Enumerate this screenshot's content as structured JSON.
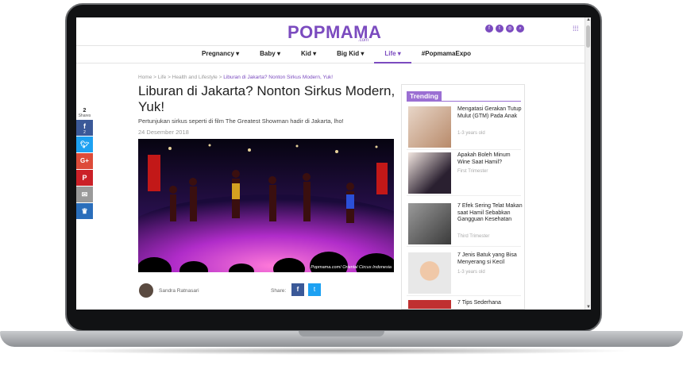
{
  "header": {
    "logo": "POPMAMA",
    "logo_sub": ".com",
    "social_icons": [
      "facebook-icon",
      "twitter-icon",
      "instagram-icon",
      "search-icon"
    ]
  },
  "nav": {
    "items": [
      {
        "label": "Pregnancy ▾"
      },
      {
        "label": "Baby ▾"
      },
      {
        "label": "Kid ▾"
      },
      {
        "label": "Big Kid ▾"
      },
      {
        "label": "Life ▾"
      },
      {
        "label": "#PopmamaExpo"
      }
    ],
    "active_index": 4
  },
  "sharebar": {
    "count": "2",
    "label": "Shares",
    "fb_count": "2"
  },
  "article": {
    "breadcrumb": {
      "home": "Home",
      "life": "Life",
      "section": "Health and Lifestyle",
      "current": "Liburan di Jakarta? Nonton Sirkus Modern, Yuk!",
      "sep": ">"
    },
    "title": "Liburan di Jakarta? Nonton Sirkus Modern, Yuk!",
    "lead": "Pertunjukan sirkus seperti di film The Greatest Showman hadir di Jakarta, lho!",
    "date": "24 Desember 2018",
    "image_caption": "Popmama.com/ Oriental Circus Indonesia",
    "author": "Sandra Ratnasari",
    "share_label": "Share:"
  },
  "trending": {
    "heading": "Trending",
    "items": [
      {
        "title": "Mengatasi Gerakan Tutup Mulut (GTM) Pada Anak",
        "meta": "1-3 years old"
      },
      {
        "title": "Apakah Boleh Minum Wine Saat Hamil?",
        "meta": "First Trimester"
      },
      {
        "title": "7 Efek Sering Telat Makan saat Hamil Sebabkan Gangguan Kesehatan",
        "meta": "Third Trimester"
      },
      {
        "title": "7 Jenis Batuk yang Bisa Menyerang si Kecil",
        "meta": "1-3 years old"
      },
      {
        "title": "7 Tips Sederhana",
        "meta": ""
      }
    ]
  },
  "colors": {
    "brand": "#7b4bbf",
    "facebook": "#3b5998",
    "twitter": "#1da1f2",
    "googleplus": "#dd4b39",
    "pinterest": "#cb2027",
    "email": "#9a9a9a",
    "crown": "#2a6ebb"
  }
}
